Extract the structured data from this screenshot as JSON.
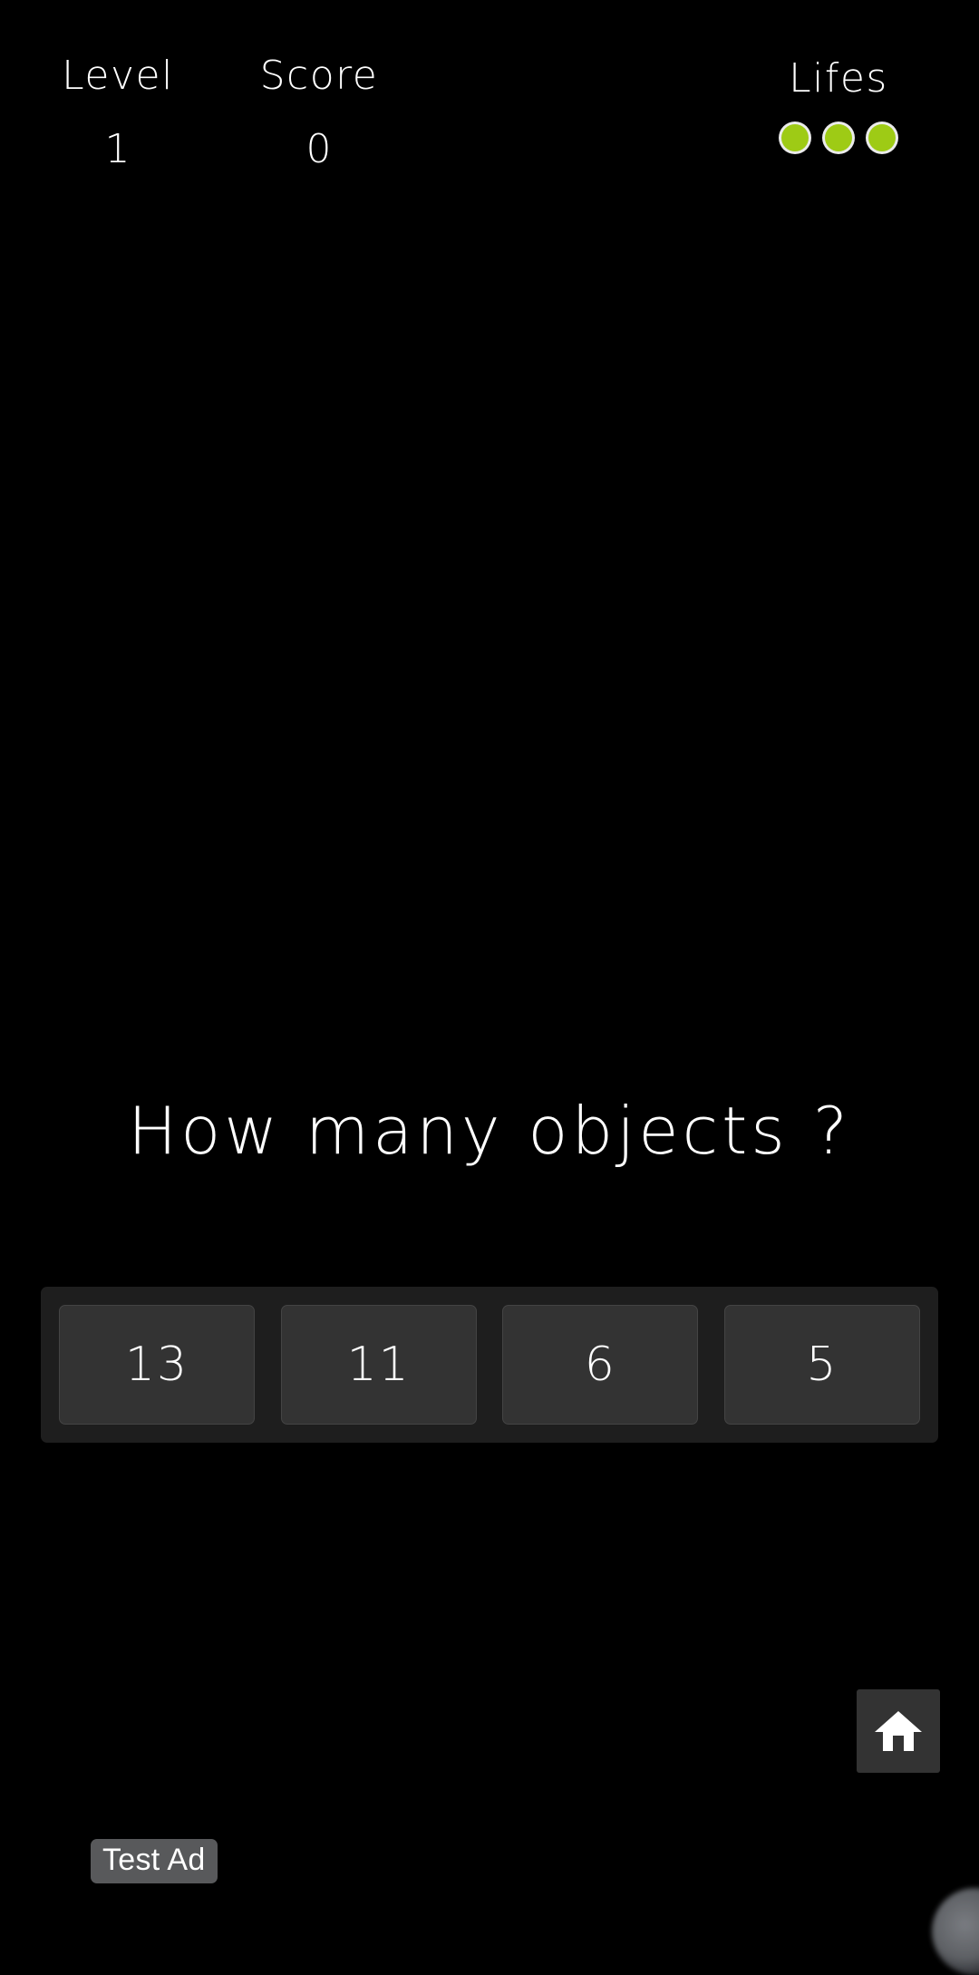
{
  "app": {
    "background_color": "#000000",
    "accent_green": "#9ecb15",
    "panel_color": "#1e1e1e",
    "button_color": "#333333"
  },
  "hud": {
    "level": {
      "label": "Level",
      "value": "1"
    },
    "score": {
      "label": "Score",
      "value": "0"
    },
    "lifes": {
      "label": "Lifes",
      "count": 3,
      "dot_color": "#9ecb15"
    }
  },
  "question": {
    "text": "How many objects ?"
  },
  "answers": {
    "options": [
      {
        "label": "13"
      },
      {
        "label": "11"
      },
      {
        "label": "6"
      },
      {
        "label": "5"
      }
    ]
  },
  "controls": {
    "home": {
      "icon": "home-icon",
      "label": "Home"
    }
  },
  "ad": {
    "badge_label": "Test Ad"
  }
}
